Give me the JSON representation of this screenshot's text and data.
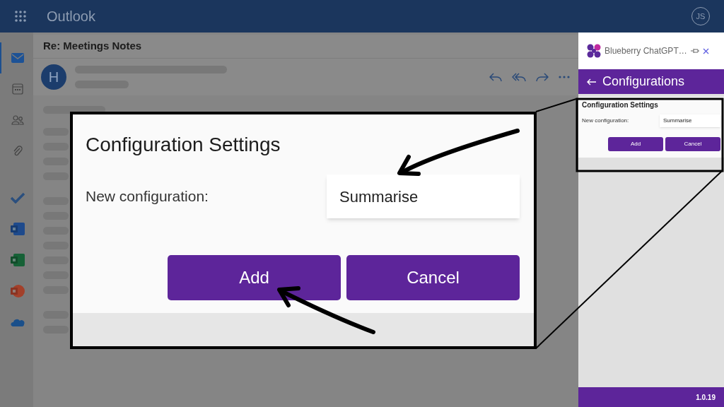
{
  "app_bar": {
    "title": "Outlook",
    "account_initials": "JS"
  },
  "rail": [
    {
      "kind": "mail",
      "selected": true
    },
    {
      "kind": "calendar",
      "selected": false
    },
    {
      "kind": "people",
      "selected": false
    },
    {
      "kind": "attachments",
      "selected": false
    },
    {
      "kind": "todo",
      "selected": false
    },
    {
      "kind": "word",
      "selected": false
    },
    {
      "kind": "excel",
      "selected": false
    },
    {
      "kind": "powerpoint",
      "selected": false
    },
    {
      "kind": "onedrive",
      "selected": false
    }
  ],
  "email": {
    "subject": "Re: Meetings Notes",
    "sender_initial": "H"
  },
  "add_in": {
    "title": "Blueberry ChatGPT…",
    "page_title": "Configurations",
    "section_title": "Configuration Settings",
    "field_label": "New configuration:",
    "field_value": "Summarise",
    "buttons": [
      "Add",
      "Cancel"
    ],
    "version": "1.0.19"
  },
  "callout": {
    "section_title": "Configuration Settings",
    "field_label": "New configuration:",
    "field_value": "Summarise",
    "buttons": [
      "Add",
      "Cancel"
    ]
  }
}
